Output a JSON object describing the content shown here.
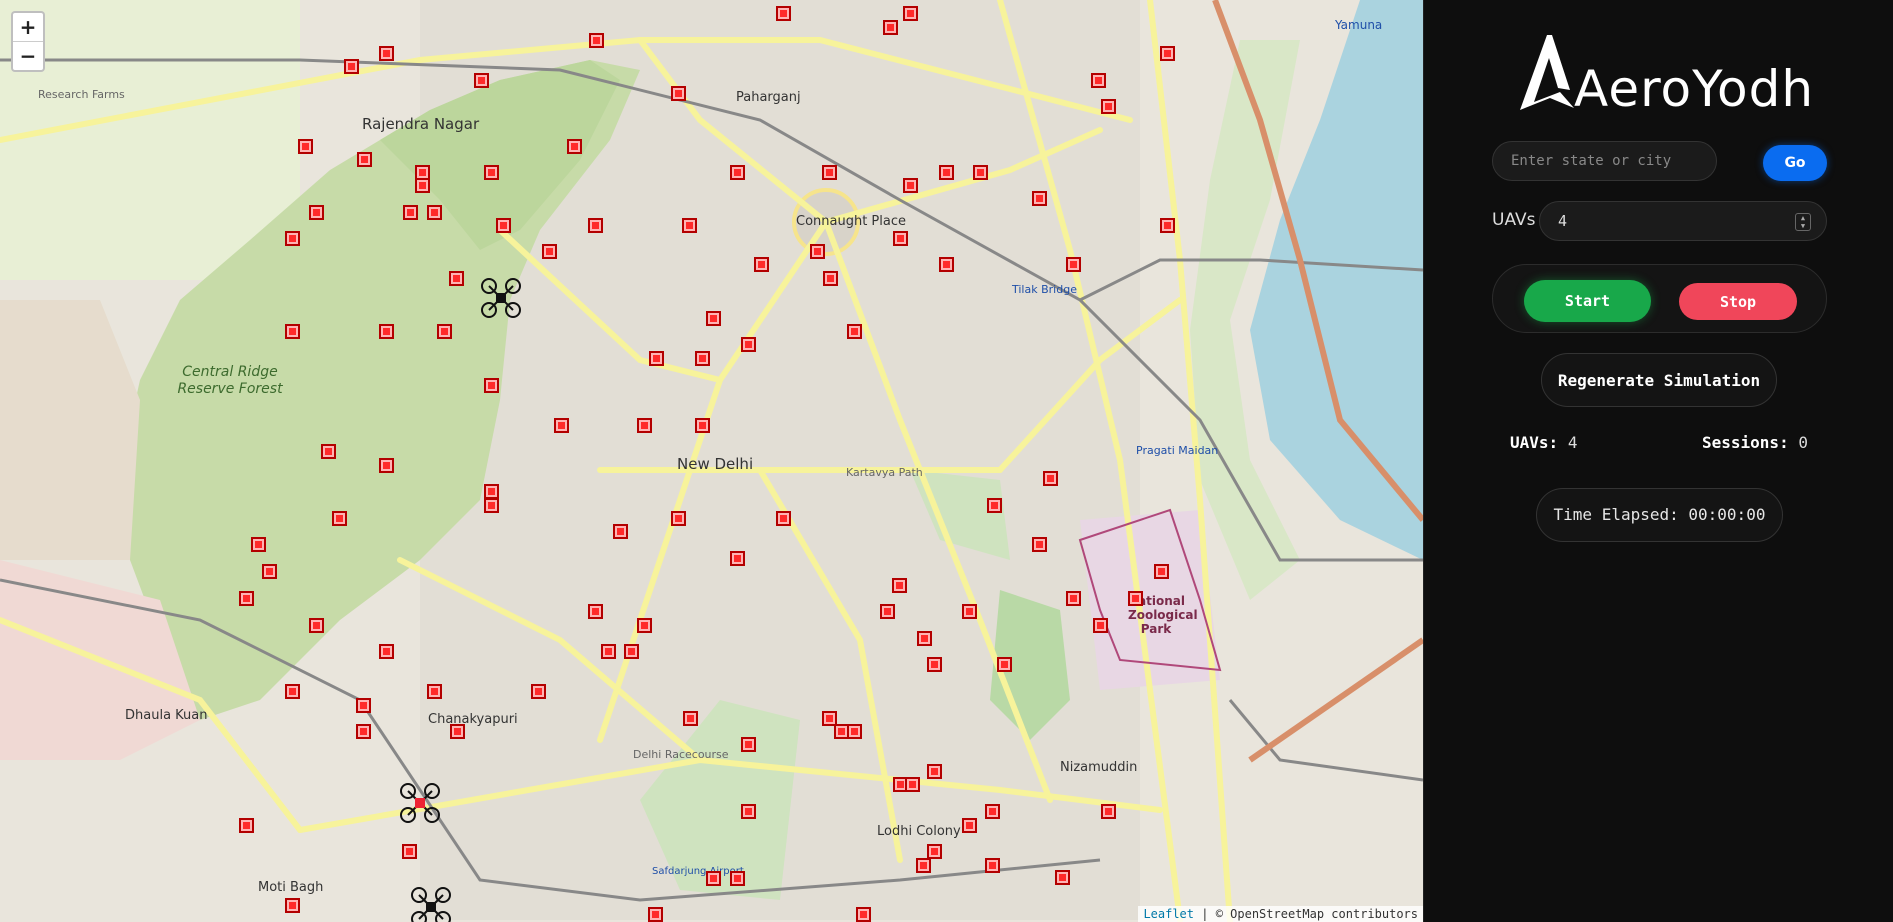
{
  "map": {
    "zoom_in": "+",
    "zoom_out": "−",
    "attribution_link": "Leaflet",
    "attribution_text": "| © OpenStreetMap contributors",
    "labels": {
      "rajendra_nagar": "Rajendra Nagar",
      "central_ridge": "Central Ridge Reserve Forest",
      "new_delhi": "New Delhi",
      "connaught_place": "Connaught Place",
      "paharganj": "Paharganj",
      "chanakyapuri": "Chanakyapuri",
      "dhaula_kuan": "Dhaula Kuan",
      "lodhi_colony": "Lodhi Colony",
      "moti_bagh": "Moti Bagh",
      "nizamuddin": "Nizamuddin",
      "national_zoo": "National Zoological Park",
      "research_farms": "Research Farms",
      "yamuna": "Yamuna",
      "safdarjung_airport": "Safdarjung Airport",
      "delhi_racecourse": "Delhi Racecourse",
      "pragati_maidan": "Pragati Maidan",
      "tilak_bridge": "Tilak Bridge",
      "kartavya_path": "Kartavya Path"
    }
  },
  "brand": {
    "logo_text": "AeroYodha"
  },
  "search": {
    "placeholder": "Enter state or city",
    "value": ""
  },
  "go_label": "Go",
  "uav_field": {
    "label": "UAVs",
    "value": "4"
  },
  "controls": {
    "start_label": "Start",
    "stop_label": "Stop",
    "regen_label": "Regenerate Simulation"
  },
  "stats": {
    "uavs_label": "UAVs:",
    "uavs_value": "4",
    "sessions_label": "Sessions:",
    "sessions_value": "0"
  },
  "timer": {
    "text": "Time Elapsed: 00:00:00"
  },
  "colors": {
    "accent_blue": "#0a6cf0",
    "start_green": "#18a84a",
    "stop_red": "#f0465a",
    "marker_red": "#ff2a2a"
  },
  "icons": {
    "drone": "quadcopter-icon",
    "marker": "red-square-marker"
  }
}
